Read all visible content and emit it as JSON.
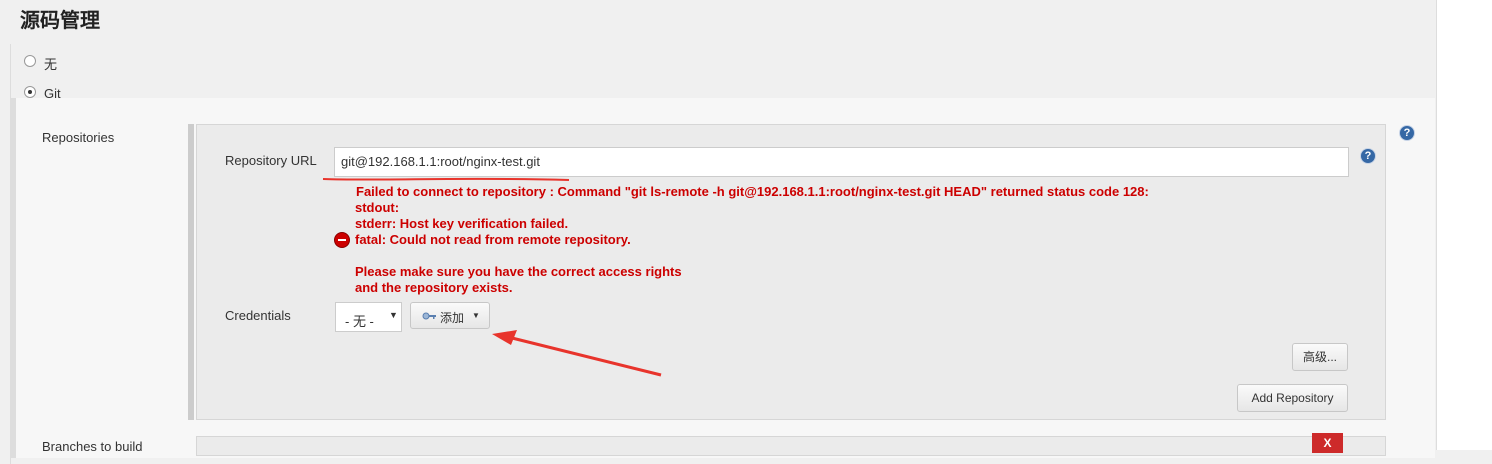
{
  "page": {
    "title": "源码管理"
  },
  "scm": {
    "options": [
      {
        "label": "无",
        "checked": false
      },
      {
        "label": "Git",
        "checked": true
      }
    ]
  },
  "repositories": {
    "label": "Repositories",
    "url_label": "Repository URL",
    "url_value": "git@192.168.1.1:root/nginx-test.git",
    "error_lines": [
      "Failed to connect to repository : Command \"git ls-remote -h git@192.168.1.1:root/nginx-test.git HEAD\" returned status code 128:",
      "stdout:",
      "stderr: Host key verification failed.",
      "fatal: Could not read from remote repository.",
      "",
      "Please make sure you have the correct access rights",
      "and the repository exists."
    ],
    "credentials_label": "Credentials",
    "credentials_selected": "- 无 -",
    "add_button_label": "添加",
    "advanced_button_label": "高级...",
    "add_repository_button_label": "Add Repository"
  },
  "branches": {
    "label": "Branches to build",
    "delete_button_label": "X"
  },
  "help_icon_glyph": "?",
  "colors": {
    "error": "#cc0000",
    "annotation": "#e8342c",
    "help": "#3568a5"
  }
}
